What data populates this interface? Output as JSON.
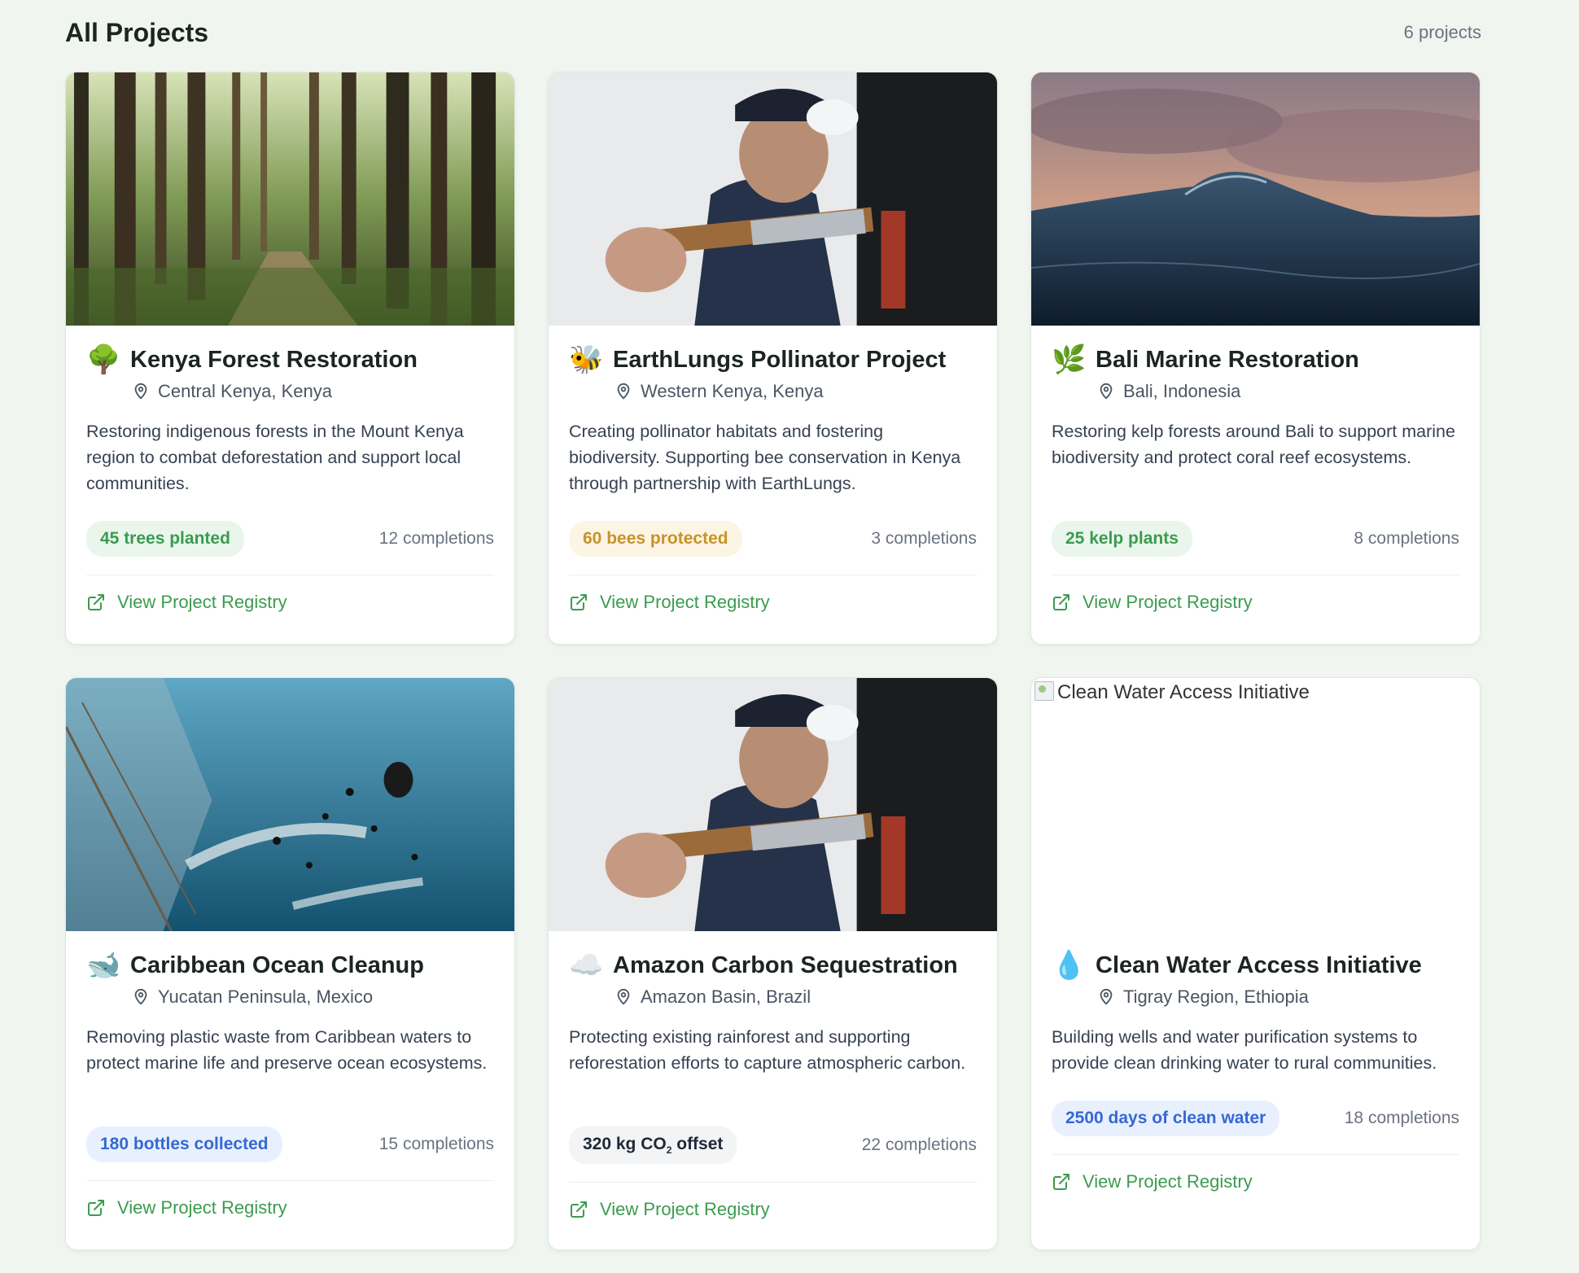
{
  "header": {
    "title": "All Projects",
    "count": "6 projects"
  },
  "link_label": "View Project Registry",
  "projects": [
    {
      "emoji": "🌳",
      "emoji_icon": "tree-icon",
      "title": "Kenya Forest Restoration",
      "location": "Central Kenya, Kenya",
      "description": "Restoring indigenous forests in the Mount Kenya region to combat deforestation and support local communities.",
      "impact": "45 trees planted",
      "impact_color": "green",
      "completions": "12 completions"
    },
    {
      "emoji": "🐝",
      "emoji_icon": "bee-icon",
      "title": "EarthLungs Pollinator Project",
      "location": "Western Kenya, Kenya",
      "description": "Creating pollinator habitats and fostering biodiversity. Supporting bee conservation in Kenya through partnership with EarthLungs.",
      "impact": "60 bees protected",
      "impact_color": "amber",
      "completions": "3 completions"
    },
    {
      "emoji": "🌿",
      "emoji_icon": "herb-icon",
      "title": "Bali Marine Restoration",
      "location": "Bali, Indonesia",
      "description": "Restoring kelp forests around Bali to support marine biodiversity and protect coral reef ecosystems.",
      "impact": "25 kelp plants",
      "impact_color": "green",
      "completions": "8 completions"
    },
    {
      "emoji": "🐋",
      "emoji_icon": "whale-icon",
      "title": "Caribbean Ocean Cleanup",
      "location": "Yucatan Peninsula, Mexico",
      "description": "Removing plastic waste from Caribbean waters to protect marine life and preserve ocean ecosystems.",
      "impact": "180 bottles collected",
      "impact_color": "blue",
      "completions": "15 completions"
    },
    {
      "emoji": "☁️",
      "emoji_icon": "cloud-icon",
      "title": "Amazon Carbon Sequestration",
      "location": "Amazon Basin, Brazil",
      "description": "Protecting existing rainforest and supporting reforestation efforts to capture atmospheric carbon.",
      "impact_prefix": "320 kg CO",
      "impact_sub": "2",
      "impact_suffix": " offset",
      "impact_color": "gray",
      "completions": "22 completions"
    },
    {
      "emoji": "💧",
      "emoji_icon": "droplet-icon",
      "title": "Clean Water Access Initiative",
      "image_alt": "Clean Water Access Initiative",
      "location": "Tigray Region, Ethiopia",
      "description": "Building wells and water purification systems to provide clean drinking water to rural communities.",
      "impact": "2500 days of clean water",
      "impact_color": "blue",
      "completions": "18 completions"
    }
  ]
}
